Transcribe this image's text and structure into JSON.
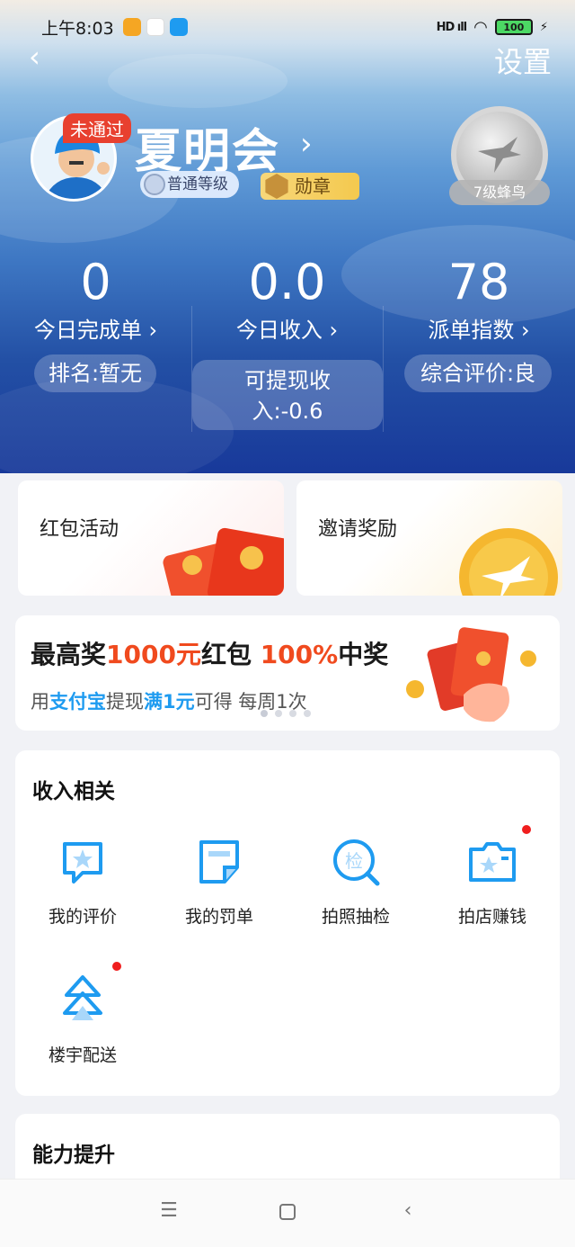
{
  "status_bar": {
    "time": "上午8:03",
    "signal": "HD ıll",
    "battery": "100"
  },
  "header": {
    "back_icon": "chevron-left-icon",
    "settings_label": "设置"
  },
  "profile": {
    "badge_status": "未通过",
    "name": "夏明会",
    "level_label": "普通等级",
    "medal_label": "勋章",
    "rank_title": "7级蜂鸟"
  },
  "stats": [
    {
      "value": "0",
      "label": "今日完成单",
      "pill": "排名:暂无"
    },
    {
      "value": "0.0",
      "label": "今日收入",
      "pill": "可提现收入:-0.6"
    },
    {
      "value": "78",
      "label": "派单指数",
      "pill": "综合评价:良"
    }
  ],
  "promos": [
    {
      "label": "红包活动"
    },
    {
      "label": "邀请奖励"
    }
  ],
  "banner": {
    "title_a": "最高奖",
    "title_b": "1000元",
    "title_c": "红包 ",
    "title_d": "100%",
    "title_e": "中奖",
    "sub_a": "用",
    "sub_b": "支付宝",
    "sub_c": "提现",
    "sub_d": "满1元",
    "sub_e": "可得 每周1次"
  },
  "income_section": {
    "title": "收入相关",
    "items": [
      {
        "label": "我的评价",
        "icon": "star-comment-icon"
      },
      {
        "label": "我的罚单",
        "icon": "ticket-document-icon"
      },
      {
        "label": "拍照抽检",
        "icon": "inspection-search-icon"
      },
      {
        "label": "拍店赚钱",
        "icon": "camera-star-icon"
      },
      {
        "label": "楼宇配送",
        "icon": "building-delivery-icon"
      }
    ]
  },
  "ability_section": {
    "title": "能力提升"
  },
  "nav": {
    "menu_icon": "menu-icon",
    "home_icon": "home-square-icon",
    "back_icon": "back-triangle-icon"
  },
  "colors": {
    "accent": "#1e9bf0",
    "highlight": "#f04a1e",
    "hero_dark": "#18399a"
  }
}
